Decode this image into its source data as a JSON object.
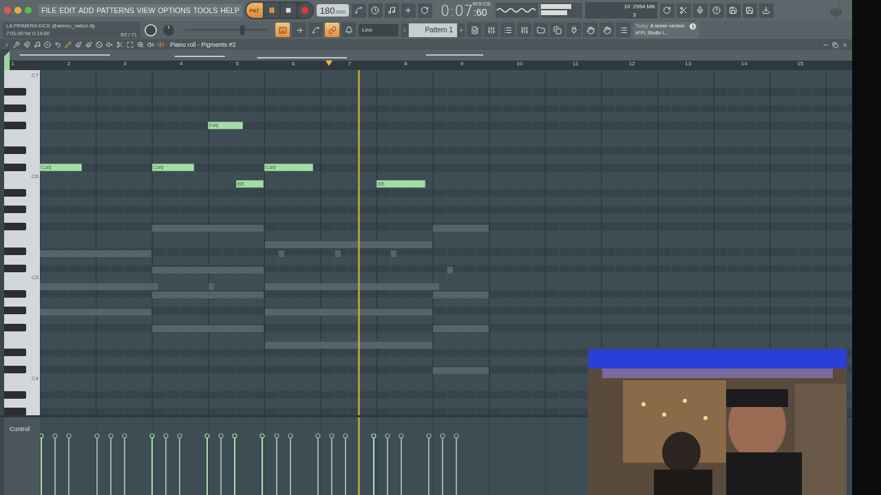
{
  "menu": [
    "FILE",
    "EDIT",
    "ADD",
    "PATTERNS",
    "VIEW",
    "OPTIONS",
    "TOOLS",
    "HELP"
  ],
  "transport": {
    "mode_label": "PAT",
    "mode_selected": true,
    "playing": true
  },
  "tempo": {
    "value": "180",
    "fraction": ".000"
  },
  "time": {
    "value": "0:07",
    "centis": ":60",
    "format": "M:S:CS"
  },
  "monitor": {
    "cpu": "19",
    "memory": "2954 MB",
    "polyphony": "3"
  },
  "song": {
    "title": "LA PRIMERA  KICK @ammu_nation.flp",
    "time": "7:01:00 for 0:14:00",
    "note": "B5 / 71"
  },
  "pitch_slider": {
    "level": 0.7
  },
  "view_buttons": [
    {
      "on": true
    },
    {
      "on": false
    },
    {
      "on": false
    },
    {
      "on": true
    },
    {
      "on": false
    }
  ],
  "snap": "Line",
  "pattern": "Pattern 1",
  "news": {
    "date": "Today",
    "text": "A newer version of FL Studio i…",
    "badge": "3"
  },
  "piano_roll": {
    "title": "Piano roll - Pigments #2",
    "bars": [
      "1",
      "2",
      "3",
      "4",
      "5",
      "6",
      "7",
      "8",
      "9",
      "10",
      "11",
      "12",
      "13",
      "14",
      "15"
    ],
    "key_labels": [
      "C7",
      "C6",
      "C5",
      "C4"
    ],
    "notes": [
      {
        "label": "F#6"
      },
      {
        "label": "C#6"
      },
      {
        "label": "C#6"
      },
      {
        "label": "C#6"
      },
      {
        "label": "B5"
      },
      {
        "label": "B5"
      }
    ],
    "control": "Control"
  }
}
